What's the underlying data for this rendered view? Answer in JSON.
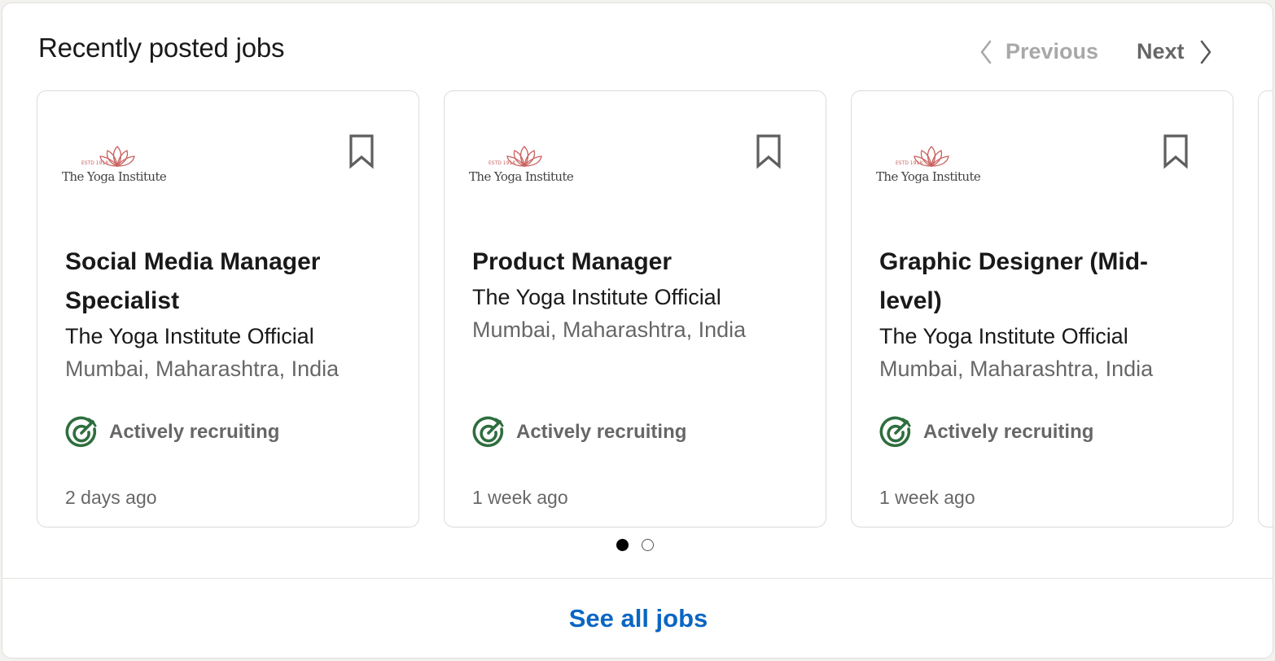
{
  "header": {
    "title": "Recently posted jobs",
    "previous_label": "Previous",
    "next_label": "Next"
  },
  "company_logo": {
    "name": "The Yoga Institute",
    "established": "ESTD 1918",
    "accent_color": "#c8625f"
  },
  "status_icon": {
    "name": "target-icon",
    "color": "#2e6e3e"
  },
  "jobs": [
    {
      "title": "Social Media Manager Specialist",
      "company": "The Yoga Institute Official",
      "location": "Mumbai, Maharashtra, India",
      "status": "Actively recruiting",
      "posted": "2 days ago"
    },
    {
      "title": "Product Manager",
      "company": "The Yoga Institute Official",
      "location": "Mumbai, Maharashtra, India",
      "status": "Actively recruiting",
      "posted": "1 week ago"
    },
    {
      "title": "Graphic Designer (Mid-level)",
      "company": "The Yoga Institute Official",
      "location": "Mumbai, Maharashtra, India",
      "status": "Actively recruiting",
      "posted": "1 week ago"
    }
  ],
  "pagination": {
    "current_page": 1,
    "total_pages": 2
  },
  "footer": {
    "see_all_label": "See all jobs",
    "link_color": "#0a66c2"
  }
}
